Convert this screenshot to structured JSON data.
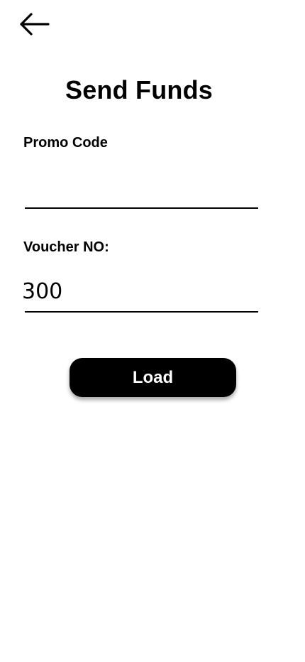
{
  "header": {
    "back_icon": "arrow-left-icon",
    "title": "Send Funds"
  },
  "form": {
    "promo_code": {
      "label": "Promo Code",
      "value": "",
      "placeholder": ""
    },
    "voucher_no": {
      "label": "Voucher NO:",
      "value": "300",
      "placeholder": ""
    },
    "load_label": "Load"
  },
  "colors": {
    "background": "#ffffff",
    "text": "#000000",
    "button_bg": "#000000",
    "button_text": "#ffffff"
  }
}
